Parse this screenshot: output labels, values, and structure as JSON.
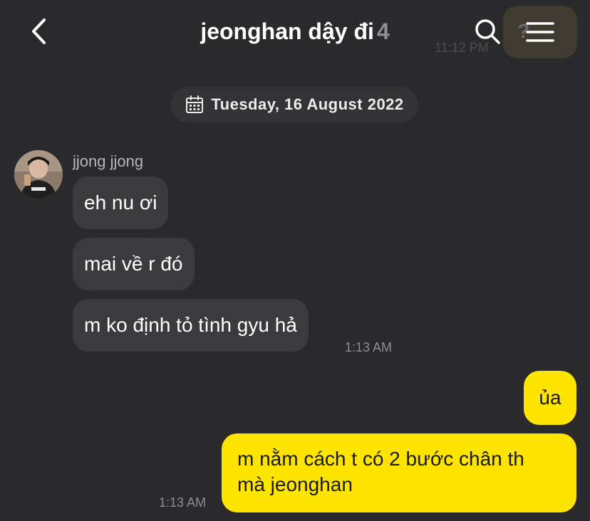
{
  "header": {
    "back_icon": "chevron-left-icon",
    "title": "jeonghan dậy đi",
    "member_count": "4",
    "search_icon": "search-icon",
    "menu_icon": "hamburger-menu-icon",
    "ghost_time": "11:12 PM",
    "ghost_mark": "?"
  },
  "date_divider": {
    "icon": "calendar-icon",
    "text": "Tuesday, 16 August 2022"
  },
  "messages": [
    {
      "direction": "incoming",
      "sender": "jjong jjong",
      "text": "eh nu ơi"
    },
    {
      "direction": "incoming",
      "text": "mai về r đó"
    },
    {
      "direction": "incoming",
      "text": "m ko định tỏ tình gyu hả",
      "time": "1:13 AM"
    },
    {
      "direction": "outgoing",
      "text": "ủa"
    },
    {
      "direction": "outgoing",
      "line1": "m nằm cách t có 2 bước chân th",
      "line2": "mà jeonghan",
      "time": "1:13 AM"
    }
  ],
  "colors": {
    "background": "#2a2a2c",
    "incoming_bubble": "#3b3b3e",
    "outgoing_bubble": "#fee500",
    "date_pill": "#333336",
    "muted_text": "#8e8e93"
  }
}
